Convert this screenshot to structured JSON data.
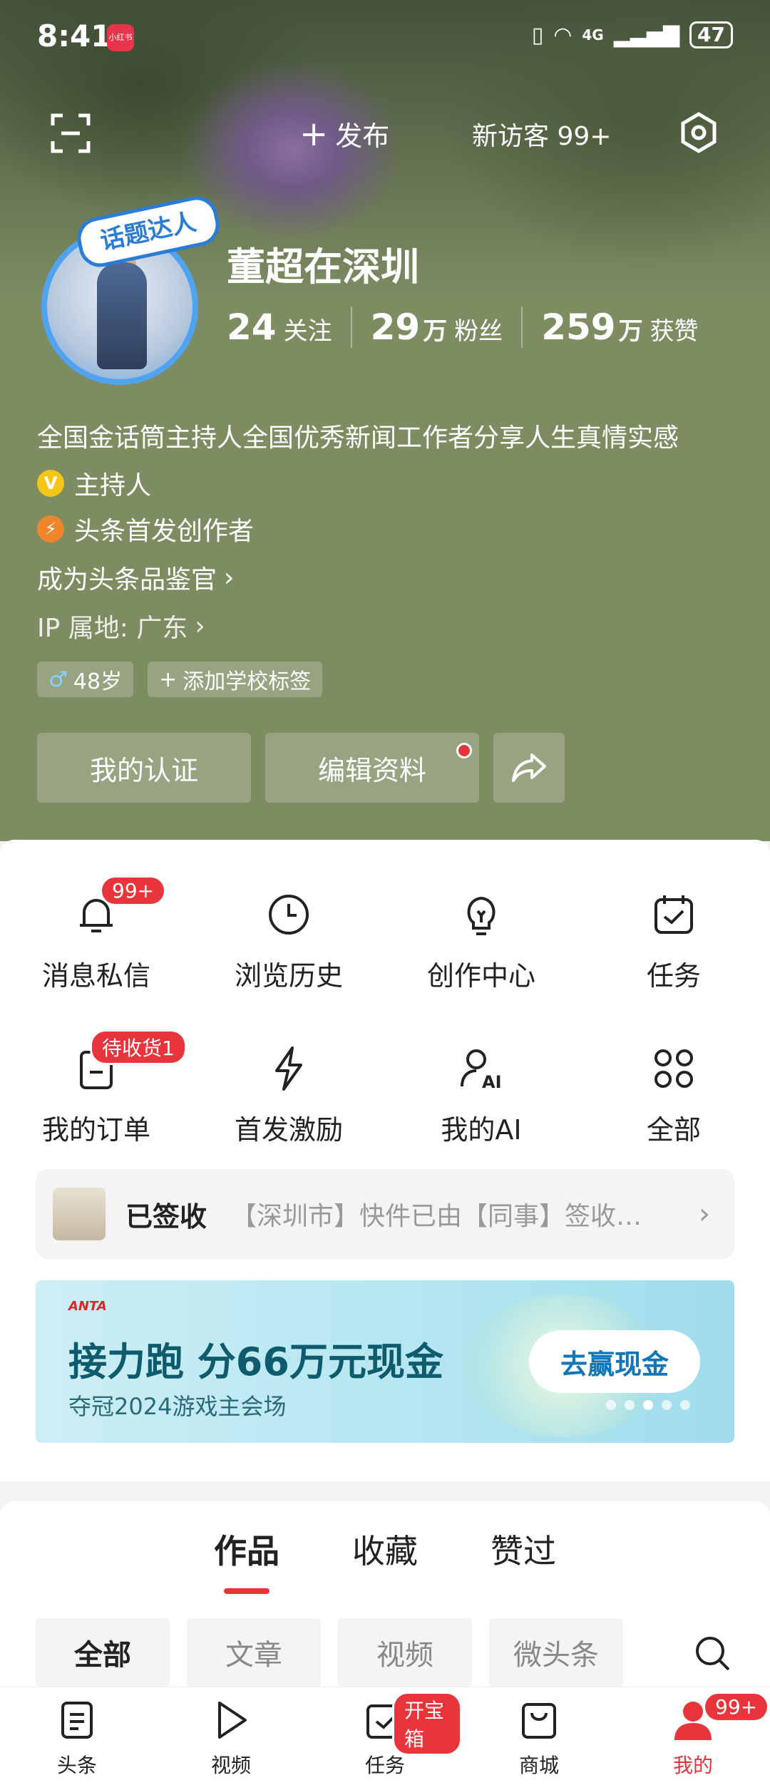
{
  "status_bar": {
    "time": "8:41",
    "app_badge": "小红书",
    "network": "4G",
    "battery": "47"
  },
  "topbar": {
    "publish_label": "发布",
    "visitor_label": "新访客 99+"
  },
  "profile": {
    "topic_badge": "话题达人",
    "name": "董超在深圳",
    "stats": [
      {
        "num": "24",
        "unit": "",
        "label": "关注"
      },
      {
        "num": "29",
        "unit": "万",
        "label": "粉丝"
      },
      {
        "num": "259",
        "unit": "万",
        "label": "获赞"
      }
    ],
    "bio": "全国金话筒主持人全国优秀新闻工作者分享人生真情实感",
    "tag_host": "主持人",
    "tag_creator": "头条首发创作者",
    "appraiser_link": "成为头条品鉴官",
    "ip": "IP 属地: 广东",
    "chip_age": "48岁",
    "chip_school": "添加学校标签",
    "btn_verify": "我的认证",
    "btn_edit": "编辑资料"
  },
  "grid": [
    {
      "label": "消息私信",
      "icon": "bell-icon",
      "badge": "99+"
    },
    {
      "label": "浏览历史",
      "icon": "clock-icon",
      "badge": ""
    },
    {
      "label": "创作中心",
      "icon": "bulb-icon",
      "badge": ""
    },
    {
      "label": "任务",
      "icon": "calendar-check-icon",
      "badge": ""
    },
    {
      "label": "我的订单",
      "icon": "order-icon",
      "badge": "待收货1"
    },
    {
      "label": "首发激励",
      "icon": "bolt-icon",
      "badge": ""
    },
    {
      "label": "我的AI",
      "icon": "ai-person-icon",
      "badge": ""
    },
    {
      "label": "全部",
      "icon": "grid-icon",
      "badge": ""
    }
  ],
  "delivery": {
    "status": "已签收",
    "text": "【深圳市】快件已由【同事】签收…"
  },
  "banner": {
    "brand": "ANTA",
    "title": "接力跑 分66万元现金",
    "subtitle": "夺冠2024游戏主会场",
    "button": "去赢现金"
  },
  "tabs": [
    "作品",
    "收藏",
    "赞过"
  ],
  "filters": [
    "全部",
    "文章",
    "视频",
    "微头条"
  ],
  "tabbar": [
    {
      "label": "头条",
      "icon": "news-icon",
      "badge": ""
    },
    {
      "label": "视频",
      "icon": "play-icon",
      "badge": ""
    },
    {
      "label": "任务",
      "icon": "task-icon",
      "badge": "开宝箱"
    },
    {
      "label": "商城",
      "icon": "shop-icon",
      "badge": ""
    },
    {
      "label": "我的",
      "icon": "user-icon",
      "badge": "99+"
    }
  ],
  "colors": {
    "hero_bg": "#7e8c62",
    "accent_red": "#e8343b",
    "banner_btn_text": "#1076b8"
  }
}
